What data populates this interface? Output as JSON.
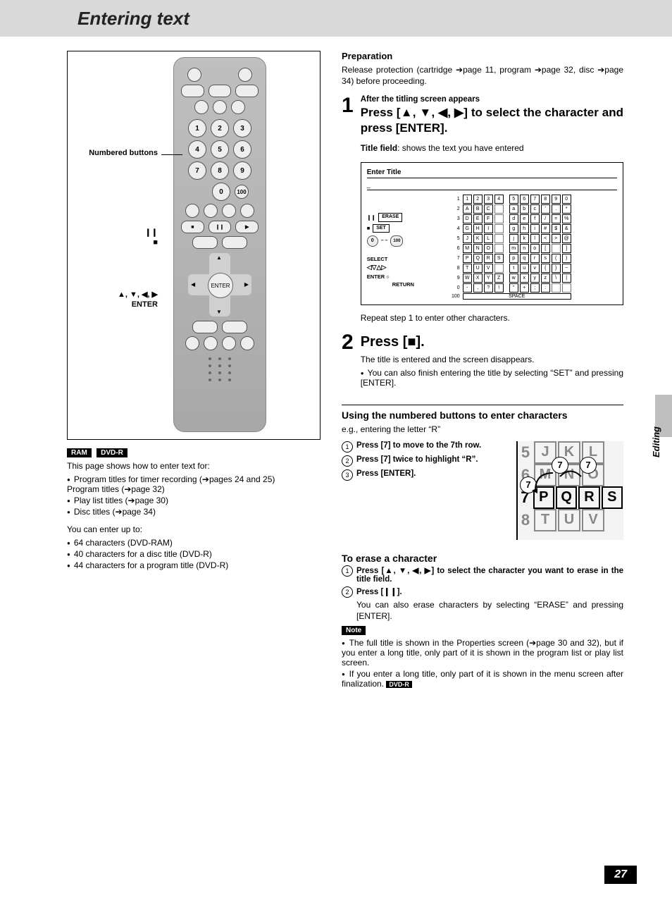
{
  "title": "Entering text",
  "section_tab": "Editing",
  "page_number": "27",
  "remote_annotations": {
    "numbered": "Numbered buttons",
    "pause_stop": "❙❙\n■",
    "dpad": "▲, ▼, ◀, ▶\nENTER"
  },
  "left": {
    "badges": [
      "RAM",
      "DVD-R"
    ],
    "intro": "This page shows how to enter text for:",
    "intro_bullets": [
      "Program titles for timer recording (➔pages 24 and 25)\nProgram titles (➔page 32)",
      "Play list titles (➔page 30)",
      "Disc titles (➔page 34)"
    ],
    "limits_intro": "You can enter up to:",
    "limits_bullets": [
      "64 characters (DVD-RAM)",
      "40 characters for a disc title (DVD-R)",
      "44 characters for a program title (DVD-R)"
    ]
  },
  "right": {
    "prep_head": "Preparation",
    "prep_body": "Release protection (cartridge ➔page 11, program ➔page 32, disc ➔page 34) before proceeding.",
    "step1": {
      "pre": "After the titling screen appears",
      "main": "Press [▲, ▼, ◀, ▶] to select the character and press [ENTER].",
      "title_field": "Title field: shows the text you have entered",
      "repeat": "Repeat step 1 to enter other characters."
    },
    "charscreen": {
      "title": "Enter Title",
      "left_labels": {
        "erase": "ERASE",
        "set": "SET",
        "select": "SELECT",
        "enter": "ENTER",
        "return": "RETURN",
        "zero": "0",
        "hundred": "100"
      },
      "rows": [
        {
          "n": "1",
          "cells": [
            "1",
            "2",
            "3",
            "4",
            "5",
            "6",
            "7",
            "8",
            "9",
            "0"
          ]
        },
        {
          "n": "2",
          "cells": [
            "A",
            "B",
            "C",
            "",
            "a",
            "b",
            "c",
            "’",
            ".",
            "*"
          ]
        },
        {
          "n": "3",
          "cells": [
            "D",
            "E",
            "F",
            "",
            "d",
            "e",
            "f",
            "/",
            "=",
            "%"
          ]
        },
        {
          "n": "4",
          "cells": [
            "G",
            "H",
            "I",
            "",
            "g",
            "h",
            "i",
            "#",
            "$",
            "&"
          ]
        },
        {
          "n": "5",
          "cells": [
            "J",
            "K",
            "L",
            "",
            "j",
            "k",
            "l",
            "<",
            ">",
            "@"
          ]
        },
        {
          "n": "6",
          "cells": [
            "M",
            "N",
            "O",
            "",
            "m",
            "n",
            "o",
            "[",
            "",
            "]"
          ]
        },
        {
          "n": "7",
          "cells": [
            "P",
            "Q",
            "R",
            "S",
            "p",
            "q",
            "r",
            "s",
            "(",
            ")"
          ]
        },
        {
          "n": "8",
          "cells": [
            "T",
            "U",
            "V",
            "",
            "t",
            "u",
            "v",
            "{",
            "}",
            "~"
          ]
        },
        {
          "n": "9",
          "cells": [
            "W",
            "X",
            "Y",
            "Z",
            "w",
            "x",
            "y",
            "z",
            "\\",
            "|"
          ]
        },
        {
          "n": "0",
          "cells": [
            "-",
            ",",
            "?",
            "!",
            "”",
            "+",
            ";",
            ":",
            "",
            ""
          ]
        }
      ],
      "space_row": {
        "n": "100",
        "label": "SPACE"
      }
    },
    "step2": {
      "main": "Press [■].",
      "b1": "The title is entered and the screen disappears.",
      "b2": "You can also finish entering the title by selecting “SET” and pressing [ENTER]."
    },
    "numbered": {
      "head": "Using the numbered buttons to enter characters",
      "eg": "e.g., entering the letter “R”",
      "steps": [
        "Press [7] to move to the 7th row.",
        "Press [7] twice to highlight “R”.",
        "Press [ENTER]."
      ],
      "zoom_rows": [
        {
          "n": "5",
          "cells": [
            "J",
            "K",
            "L"
          ]
        },
        {
          "n": "6",
          "cells": [
            "M",
            "N",
            "O"
          ]
        },
        {
          "n": "7",
          "cells": [
            "P",
            "Q",
            "R",
            "S"
          ],
          "sel": 2
        },
        {
          "n": "8",
          "cells": [
            "T",
            "U",
            "V"
          ]
        }
      ]
    },
    "erase": {
      "head": "To erase a character",
      "s1": "Press [▲, ▼, ◀, ▶] to select the character you want to erase in the title field.",
      "s2a": "Press [❙❙].",
      "s2b": "You can also erase characters by selecting “ERASE” and pressing [ENTER]."
    },
    "note": {
      "label": "Note",
      "n1": "The full title is shown in the Properties screen (➔page 30 and 32), but if you enter a long title, only part of it is shown in the program list or play list screen.",
      "n2": "If you enter a long title, only part of it is shown in the menu screen after finalization.",
      "n2_badge": "DVD-R"
    }
  }
}
